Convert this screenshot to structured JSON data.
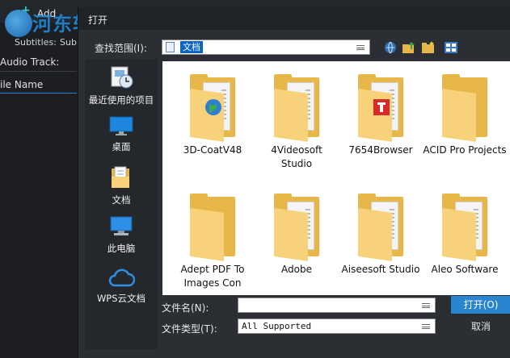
{
  "background_app": {
    "add_label": "Add",
    "subtitles_label": "Subtitles:",
    "sub_value": "Sub",
    "audio_track_label": "Audio Track:",
    "file_name_header": "ile Name"
  },
  "watermark": {
    "text": "河东软件园"
  },
  "dialog": {
    "title": "打开",
    "look_in_label": "查找范围(I):",
    "look_in_value": "文档",
    "file_name_label": "文件名(N):",
    "file_name_value": "",
    "file_type_label": "文件类型(T):",
    "file_type_value": "All Supported",
    "open_button": "打开(O)",
    "cancel_button": "取消"
  },
  "places": [
    {
      "label": "最近使用的项目",
      "icon": "recent-items-icon"
    },
    {
      "label": "桌面",
      "icon": "desktop-icon"
    },
    {
      "label": "文档",
      "icon": "documents-icon"
    },
    {
      "label": "此电脑",
      "icon": "this-pc-icon"
    },
    {
      "label": "WPS云文档",
      "icon": "wps-cloud-icon"
    }
  ],
  "files": [
    {
      "name": "3D-CoatV48",
      "badge": "globe"
    },
    {
      "name": "4Videosoft Studio",
      "badge": ""
    },
    {
      "name": "7654Browser",
      "badge": "red-app"
    },
    {
      "name": "ACID Pro Projects",
      "badge": ""
    },
    {
      "name": "Adept PDF To Images Con",
      "badge": ""
    },
    {
      "name": "Adobe",
      "badge": ""
    },
    {
      "name": "Aiseesoft Studio",
      "badge": ""
    },
    {
      "name": "Aleo Software",
      "badge": ""
    }
  ],
  "colors": {
    "accent": "#2a85d0",
    "folder": "#e8b74a",
    "dialog_bg": "#2b2e33"
  }
}
